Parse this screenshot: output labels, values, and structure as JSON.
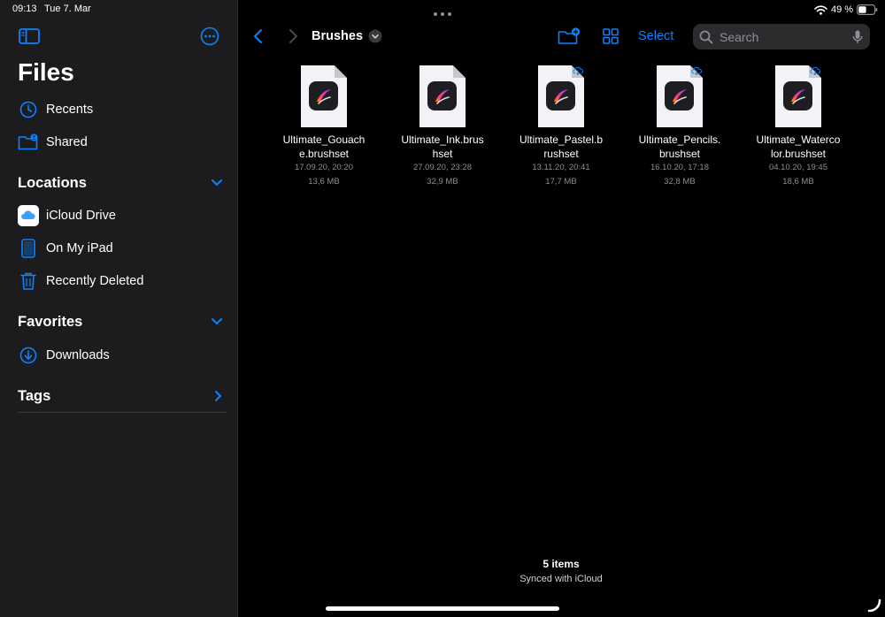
{
  "status_bar": {
    "time": "09:13",
    "date": "Tue 7. Mar",
    "battery": "49 %"
  },
  "sidebar": {
    "title": "Files",
    "top_items": [
      {
        "label": "Recents",
        "icon": "clock-icon"
      },
      {
        "label": "Shared",
        "icon": "shared-folder-icon"
      }
    ],
    "sections": [
      {
        "title": "Locations",
        "items": [
          {
            "label": "iCloud Drive",
            "icon": "icloud-icon"
          },
          {
            "label": "On My iPad",
            "icon": "ipad-icon"
          },
          {
            "label": "Recently Deleted",
            "icon": "trash-icon"
          }
        ]
      },
      {
        "title": "Favorites",
        "items": [
          {
            "label": "Downloads",
            "icon": "download-icon"
          }
        ]
      },
      {
        "title": "Tags",
        "items": []
      }
    ]
  },
  "toolbar": {
    "folder_name": "Brushes",
    "select_label": "Select",
    "search_placeholder": "Search"
  },
  "files": [
    {
      "name": "Ultimate_Gouache.brushset",
      "line1": "Ultimate_Gouach",
      "line2": "e.brushset",
      "date": "17.09.20, 20:20",
      "size": "13,6 MB",
      "cloud": false
    },
    {
      "name": "Ultimate_Ink.brushset",
      "line1": "Ultimate_Ink.brus",
      "line2": "hset",
      "date": "27.09.20, 23:28",
      "size": "32,9 MB",
      "cloud": false
    },
    {
      "name": "Ultimate_Pastel.brushset",
      "line1": "Ultimate_Pastel.b",
      "line2": "rushset",
      "date": "13.11.20, 20:41",
      "size": "17,7 MB",
      "cloud": true
    },
    {
      "name": "Ultimate_Pencils.brushset",
      "line1": "Ultimate_Pencils.",
      "line2": "brushset",
      "date": "16.10.20, 17:18",
      "size": "32,8 MB",
      "cloud": true
    },
    {
      "name": "Ultimate_Watercolor.brushset",
      "line1": "Ultimate_Waterco",
      "line2": "lor.brushset",
      "date": "04.10.20, 19:45",
      "size": "18,6 MB",
      "cloud": true
    }
  ],
  "footer": {
    "count": "5 items",
    "sync_status": "Synced with iCloud"
  },
  "colors": {
    "accent": "#0a84ff",
    "sidebar_bg": "#1c1c1e",
    "main_bg": "#000000",
    "secondary_text": "#8e8e93"
  }
}
